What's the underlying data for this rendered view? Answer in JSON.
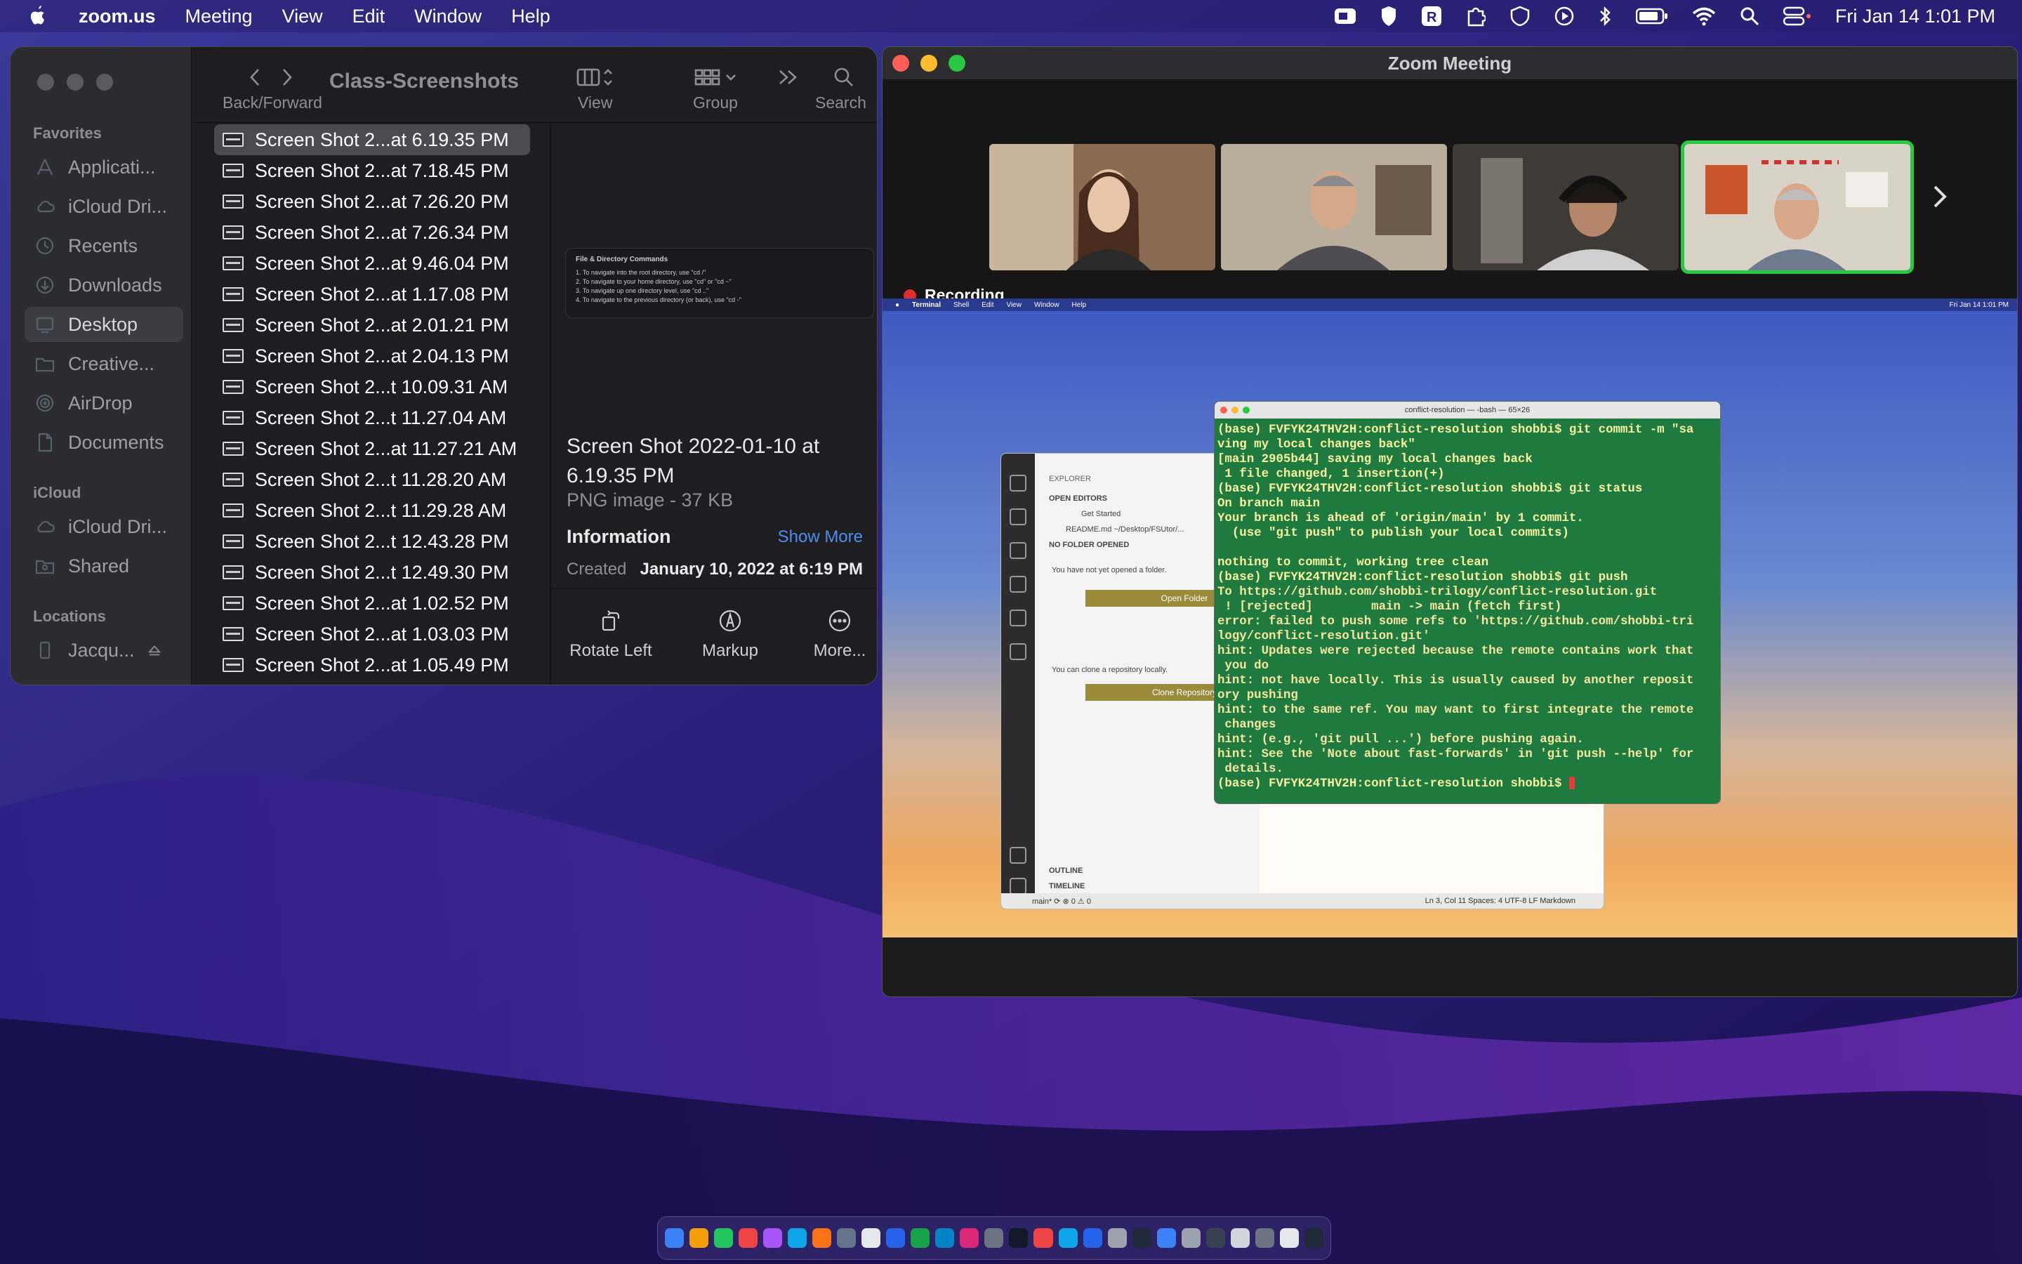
{
  "menubar": {
    "app": "zoom.us",
    "items": [
      "Meeting",
      "View",
      "Edit",
      "Window",
      "Help"
    ],
    "datetime": "Fri Jan 14  1:01 PM"
  },
  "finder": {
    "title": "Class-Screenshots",
    "toolbar": {
      "back_forward": "Back/Forward",
      "view": "View",
      "group": "Group",
      "search": "Search"
    },
    "sidebar": {
      "favorites_heading": "Favorites",
      "favorites": [
        "Applicati...",
        "iCloud Dri...",
        "Recents",
        "Downloads",
        "Desktop",
        "Creative...",
        "AirDrop",
        "Documents"
      ],
      "icloud_heading": "iCloud",
      "icloud": [
        "iCloud Dri...",
        "Shared"
      ],
      "locations_heading": "Locations",
      "locations": [
        "Jacqu..."
      ]
    },
    "files": [
      "Screen Shot 2...at 6.19.35 PM",
      "Screen Shot 2...at 7.18.45 PM",
      "Screen Shot 2...at 7.26.20 PM",
      "Screen Shot 2...at 7.26.34 PM",
      "Screen Shot 2...at 9.46.04 PM",
      "Screen Shot 2...at 1.17.08 PM",
      "Screen Shot 2...at 2.01.21 PM",
      "Screen Shot 2...at 2.04.13 PM",
      "Screen Shot 2...t 10.09.31 AM",
      "Screen Shot 2...t 11.27.04 AM",
      "Screen Shot 2...at 11.27.21 AM",
      "Screen Shot 2...t 11.28.20 AM",
      "Screen Shot 2...t 11.29.28 AM",
      "Screen Shot 2...t 12.43.28 PM",
      "Screen Shot 2...t 12.49.30 PM",
      "Screen Shot 2...at 1.02.52 PM",
      "Screen Shot 2...at 1.03.03 PM",
      "Screen Shot 2...at 1.05.49 PM"
    ],
    "preview": {
      "thumb_title": "File & Directory Commands",
      "thumb_lines": [
        "1. To navigate into the root directory, use \"cd /\"",
        "2. To navigate to your home directory, use \"cd\" or \"cd ~\"",
        "3. To navigate up one directory level, use \"cd ..\"",
        "4. To navigate to the previous directory (or back), use \"cd -\""
      ],
      "name": "Screen Shot 2022-01-10 at 6.19.35 PM",
      "type": "PNG image - 37 KB",
      "info_heading": "Information",
      "show_more": "Show More",
      "created_label": "Created",
      "created_value": "January 10, 2022 at 6:19 PM",
      "actions": [
        "Rotate Left",
        "Markup",
        "More..."
      ]
    }
  },
  "zoom": {
    "title": "Zoom Meeting",
    "recording": "Recording",
    "shared": {
      "menu": [
        "Terminal",
        "Shell",
        "Edit",
        "View",
        "Window",
        "Help"
      ],
      "menu_time": "Fri Jan 14  1:01 PM",
      "vscode": {
        "explorer": "EXPLORER",
        "open_editors": "OPEN EDITORS",
        "get_started": "Get Started",
        "readme": "README.md ~/Desktop/FSUtor/...",
        "no_folder": "NO FOLDER OPENED",
        "not_opened": "You have not yet opened a folder.",
        "open_folder": "Open Folder",
        "clone_text": "You can clone a repository locally.",
        "clone_repo": "Clone Repository",
        "outline": "OUTLINE",
        "timeline": "TIMELINE",
        "status_left": "main*   ⟳   ⊗ 0 ⚠ 0",
        "status_right": "Ln 3, Col 11    Spaces: 4    UTF-8    LF    Markdown"
      },
      "terminal": {
        "title": "conflict-resolution — -bash — 65×26",
        "lines_green": [
          "(base) FVFYK24THV2H:conflict-resolution shobbi$ git commit -m \"sa",
          "ving my local changes back\"",
          "[main 2905b44] saving my local changes back",
          " 1 file changed, 1 insertion(+)",
          "(base) FVFYK24THV2H:conflict-resolution shobbi$ git status",
          "On branch main",
          "Your branch is ahead of 'origin/main' by 1 commit.",
          "  (use \"git push\" to publish your local commits)",
          "",
          "nothing to commit, working tree clean",
          "(base) FVFYK24THV2H:conflict-resolution shobbi$ git push"
        ],
        "lines_red": [
          "To https://github.com/shobbi-trilogy/conflict-resolution.git",
          " ! [rejected]        main -> main (fetch first)",
          "error: failed to push some refs to 'https://github.com/shobbi-tri",
          "logy/conflict-resolution.git'",
          "hint: Updates were rejected because the remote contains work that",
          " you do",
          "hint: not have locally. This is usually caused by another reposit",
          "ory pushing",
          "hint: to the same ref. You may want to first integrate the remote",
          " changes",
          "hint: (e.g., 'git pull ...') before pushing again.",
          "hint: See the 'Note about fast-forwards' in 'git push --help' for",
          " details."
        ],
        "prompt": "(base) FVFYK24THV2H:conflict-resolution shobbi$ "
      }
    }
  }
}
